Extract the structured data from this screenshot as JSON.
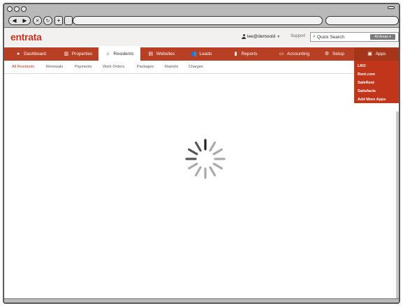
{
  "app": {
    "logo": "entrata"
  },
  "header": {
    "user": "lee@demoold",
    "support_label": "Support",
    "search_placeholder": "Quick Search",
    "areas_label": "All Areas"
  },
  "main_nav": [
    {
      "label": "Dashboard",
      "icon": "info-icon",
      "active": false
    },
    {
      "label": "Properties",
      "icon": "building-icon",
      "active": false
    },
    {
      "label": "Residents",
      "icon": "home-icon",
      "active": true
    },
    {
      "label": "Websites",
      "icon": "monitor-icon",
      "active": false
    },
    {
      "label": "Leads",
      "icon": "people-icon",
      "active": false
    },
    {
      "label": "Reports",
      "icon": "bar-chart-icon",
      "active": false
    },
    {
      "label": "Accounting",
      "icon": "money-icon",
      "active": false
    },
    {
      "label": "Setup",
      "icon": "gear-icon",
      "active": false
    },
    {
      "label": "Apps",
      "icon": "apps-icon",
      "active": false
    }
  ],
  "sub_nav": [
    {
      "label": "All Residents",
      "active": true
    },
    {
      "label": "Renewals",
      "active": false
    },
    {
      "label": "Payments",
      "active": false
    },
    {
      "label": "Work Orders",
      "active": false
    },
    {
      "label": "Packages",
      "active": false
    },
    {
      "label": "Reports",
      "active": false
    },
    {
      "label": "Charges",
      "active": false
    }
  ],
  "apps_dropdown": [
    "LRO",
    "Rent.com",
    "SafeRent",
    "Satisfacts",
    "Add More Apps"
  ],
  "colors": {
    "brand_red": "#c8331f",
    "nav_red": "#b93f24",
    "dropdown_red": "#c1351b"
  },
  "status": {
    "loading": true,
    "spinner_icon": "loading-spinner-icon"
  }
}
